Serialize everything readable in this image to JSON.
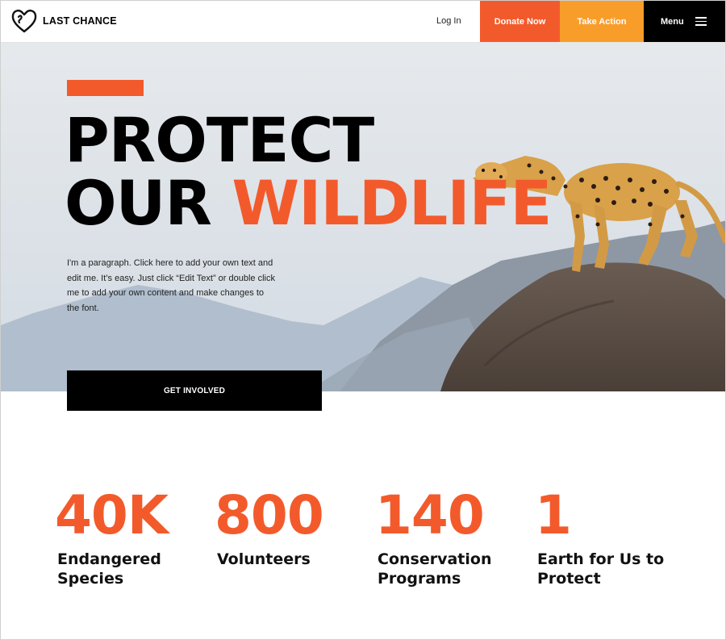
{
  "header": {
    "logo_text": "LAST CHANCE",
    "login_label": "Log In",
    "donate_label": "Donate Now",
    "action_label": "Take Action",
    "menu_label": "Menu"
  },
  "hero": {
    "headline_line1": "PROTECT",
    "headline_line2_black": "OUR",
    "headline_line2_orange": "WILDLIFE",
    "paragraph": "I'm a paragraph. Click here to add your own text and edit me. It’s easy. Just click “Edit Text” or double click me to add your own content and make changes to the font.",
    "cta_label": "GET INVOLVED"
  },
  "stats": [
    {
      "value": "40K",
      "label": "Endangered Species"
    },
    {
      "value": "800",
      "label": "Volunteers"
    },
    {
      "value": "140",
      "label": "Conservation Programs"
    },
    {
      "value": "1",
      "label": "Earth for Us to Protect"
    }
  ],
  "colors": {
    "accent_orange": "#f35a2b",
    "accent_amber": "#f99d2a",
    "dark": "#000000"
  },
  "icons": {
    "logo": "heart-logo-icon",
    "menu": "hamburger-icon"
  }
}
